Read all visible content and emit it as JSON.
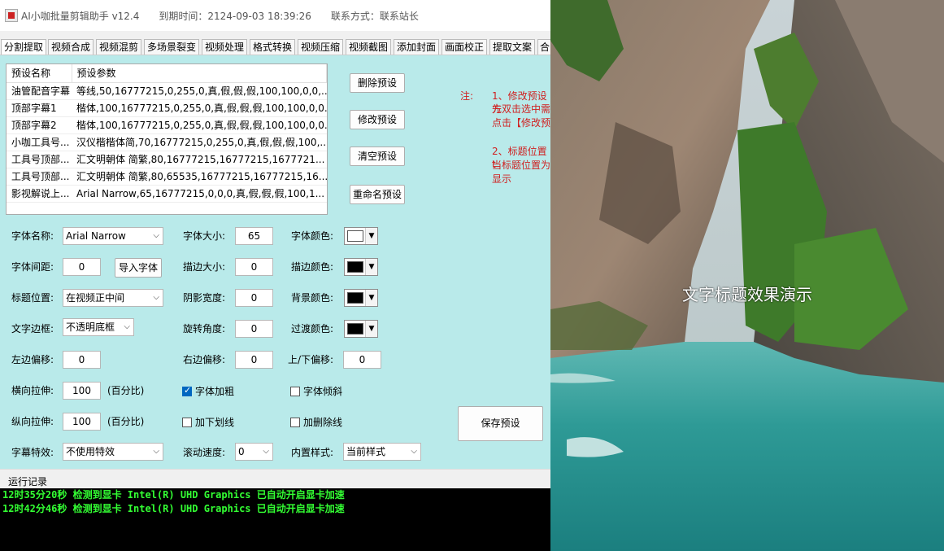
{
  "window": {
    "title": "AI小咖批量剪辑助手 v12.4",
    "expiry": "到期时间：2124-09-03 18:39:26",
    "contact": "联系方式：联系站长"
  },
  "tabs": [
    {
      "label": "分割提取"
    },
    {
      "label": "视频合成"
    },
    {
      "label": "视频混剪"
    },
    {
      "label": "多场景裂变"
    },
    {
      "label": "视频处理"
    },
    {
      "label": "格式转换"
    },
    {
      "label": "视频压缩"
    },
    {
      "label": "视频截图"
    },
    {
      "label": "添加封面"
    },
    {
      "label": "画面校正"
    },
    {
      "label": "提取文案"
    },
    {
      "label": "合"
    }
  ],
  "preset_table": {
    "headers": {
      "name": "预设名称",
      "params": "预设参数"
    },
    "rows": [
      {
        "name": "油管配音字幕",
        "params": "等线,50,16777215,0,255,0,真,假,假,假,100,100,0,0,..."
      },
      {
        "name": "顶部字幕1",
        "params": "楷体,100,16777215,0,255,0,真,假,假,假,100,100,0,0..."
      },
      {
        "name": "顶部字幕2",
        "params": "楷体,100,16777215,0,255,0,真,假,假,假,100,100,0,0..."
      },
      {
        "name": "小咖工具号...",
        "params": "汉仪楷楷体简,70,16777215,0,255,0,真,假,假,假,100,..."
      },
      {
        "name": "工具号顶部...",
        "params": "汇文明朝体 简繁,80,16777215,16777215,1677721..."
      },
      {
        "name": "工具号顶部...",
        "params": "汇文明朝体 简繁,80,65535,16777215,16777215,16..."
      },
      {
        "name": "影视解说上...",
        "params": "Arial Narrow,65,16777215,0,0,0,真,假,假,假,100,1..."
      }
    ]
  },
  "preset_buttons": {
    "delete": "删除预设",
    "modify": "修改预设",
    "clear": "清空预设",
    "rename": "重命名预设",
    "save": "保存预设"
  },
  "notes": {
    "label": "注:",
    "n1_line1": "1、修改预设方",
    "n1_line2": "先双击选中需",
    "n1_line3": "点击【修改预",
    "n2_line1": "2、标题位置t",
    "n2_line2": "当标题位置为",
    "n2_line3": "显示"
  },
  "form": {
    "font_name_label": "字体名称:",
    "font_name_value": "Arial Narrow",
    "font_size_label": "字体大小:",
    "font_size_value": "65",
    "font_color_label": "字体颜色:",
    "font_color": "#ffffff",
    "letter_spacing_label": "字体间距:",
    "letter_spacing_value": "0",
    "import_font": "导入字体",
    "stroke_size_label": "描边大小:",
    "stroke_size_value": "0",
    "stroke_color_label": "描边颜色:",
    "stroke_color": "#000000",
    "title_pos_label": "标题位置:",
    "title_pos_value": "在视频正中间",
    "shadow_width_label": "阴影宽度:",
    "shadow_width_value": "0",
    "bg_color_label": "背景颜色:",
    "bg_color": "#000000",
    "border_label": "文字边框:",
    "border_value": "不透明底框",
    "rotate_label": "旋转角度:",
    "rotate_value": "0",
    "transition_color_label": "过渡颜色:",
    "transition_color": "#000000",
    "left_offset_label": "左边偏移:",
    "left_offset_value": "0",
    "right_offset_label": "右边偏移:",
    "right_offset_value": "0",
    "vertical_offset_label": "上/下偏移:",
    "vertical_offset_value": "0",
    "h_stretch_label": "横向拉伸:",
    "h_stretch_value": "100",
    "percent1": "(百分比)",
    "v_stretch_label": "纵向拉伸:",
    "v_stretch_value": "100",
    "percent2": "(百分比)",
    "bold_label": "字体加粗",
    "bold_checked": true,
    "italic_label": "字体倾斜",
    "italic_checked": false,
    "underline_label": "加下划线",
    "underline_checked": false,
    "strike_label": "加删除线",
    "strike_checked": false,
    "effect_label": "字幕特效:",
    "effect_value": "不使用特效",
    "scroll_speed_label": "滚动速度:",
    "scroll_speed_value": "0",
    "builtin_style_label": "内置样式:",
    "builtin_style_value": "当前样式"
  },
  "log": {
    "header": "运行记录",
    "lines": [
      "12时35分20秒 检测到显卡 Intel(R) UHD Graphics 已自动开启显卡加速",
      "12时42分46秒 检测到显卡 Intel(R) UHD Graphics 已自动开启显卡加速"
    ]
  },
  "preview": {
    "caption": "文字标题效果演示"
  },
  "colors": {
    "panel_bg": "#b9eaea",
    "note_red": "#d02020",
    "log_green": "#33ff33",
    "log_bg": "#000000"
  }
}
